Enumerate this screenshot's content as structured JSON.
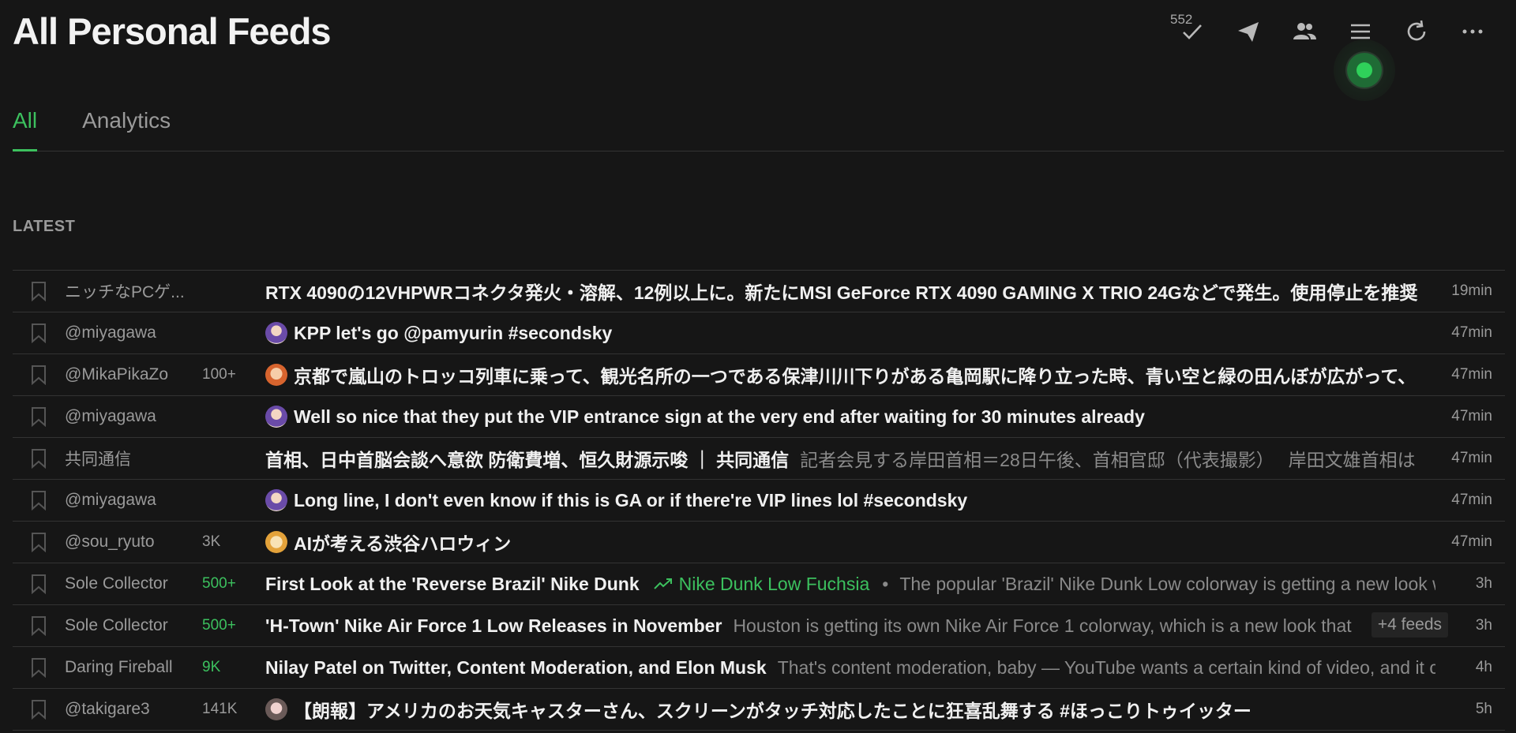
{
  "header": {
    "title": "All Personal Feeds",
    "unread_badge": "552",
    "icons": [
      "check-icon",
      "send-icon",
      "people-icon",
      "menu-icon",
      "refresh-icon",
      "more-icon"
    ]
  },
  "tabs": [
    {
      "label": "All",
      "active": true
    },
    {
      "label": "Analytics",
      "active": false
    }
  ],
  "section": {
    "label": "LATEST"
  },
  "colors": {
    "accent": "#3cc05e",
    "background": "#161616"
  },
  "rows": [
    {
      "source": "ニッチなPCゲ...",
      "count": "",
      "title": "RTX 4090の12VHPWRコネクタ発火・溶解、12例以上に。新たにMSI GeForce RTX 4090 GAMING X TRIO 24Gなどで発生。使用停止を推奨",
      "snippet": "",
      "time": "19min",
      "avatar": ""
    },
    {
      "source": "@miyagawa",
      "count": "",
      "title": "KPP let's go @pamyurin #secondsky",
      "snippet": "",
      "time": "47min",
      "avatar": "purple"
    },
    {
      "source": "@MikaPikaZo",
      "count": "100+",
      "title": "京都で嵐山のトロッコ列車に乗って、観光名所の一つである保津川川下りがある亀岡駅に降り立った時、青い空と緑の田んぼが広がって、",
      "snippet": "",
      "time": "47min",
      "avatar": "orange"
    },
    {
      "source": "@miyagawa",
      "count": "",
      "title": "Well so nice that they put the VIP entrance sign at the very end after waiting for 30 minutes already",
      "snippet": "",
      "time": "47min",
      "avatar": "purple"
    },
    {
      "source": "共同通信",
      "count": "",
      "title": "首相、日中首脳会談へ意欲 防衛費増、恒久財源示唆 ｜ 共同通信",
      "snippet": "記者会見する岸田首相＝28日午後、首相官邸（代表撮影）　 岸田文雄首相は",
      "time": "47min",
      "avatar": ""
    },
    {
      "source": "@miyagawa",
      "count": "",
      "title": "Long line, I don't even know if this is GA or if there're VIP lines lol #secondsky",
      "snippet": "",
      "time": "47min",
      "avatar": "purple"
    },
    {
      "source": "@sou_ryuto",
      "count": "3K",
      "title": "AIが考える渋谷ハロウィン",
      "snippet": "",
      "time": "47min",
      "avatar": "yellow"
    },
    {
      "source": "Sole Collector",
      "count": "500+",
      "count_green": true,
      "title": "First Look at the 'Reverse Brazil' Nike Dunk",
      "trend": "Nike Dunk Low Fuchsia",
      "separator": "•",
      "snippet": "The popular 'Brazil' Nike Dunk Low colorway is getting a new look with",
      "time": "3h",
      "avatar": ""
    },
    {
      "source": "Sole Collector",
      "count": "500+",
      "count_green": true,
      "title": "'H-Town' Nike Air Force 1 Low Releases in November",
      "snippet": "Houston is getting its own Nike Air Force 1 colorway, which is a new look that",
      "extra": "+4 feeds",
      "time": "3h",
      "avatar": ""
    },
    {
      "source": "Daring Fireball",
      "count": "9K",
      "count_green": true,
      "title": "Nilay Patel on Twitter, Content Moderation, and Elon Musk",
      "snippet": "That's content moderation, baby — YouTube wants a certain kind of video, and it cr",
      "time": "4h",
      "avatar": ""
    },
    {
      "source": "@takigare3",
      "count": "141K",
      "title": "【朗報】アメリカのお天気キャスターさん、スクリーンがタッチ対応したことに狂喜乱舞する #ほっこりトゥイッター",
      "snippet": "",
      "time": "5h",
      "avatar": "gray"
    }
  ]
}
